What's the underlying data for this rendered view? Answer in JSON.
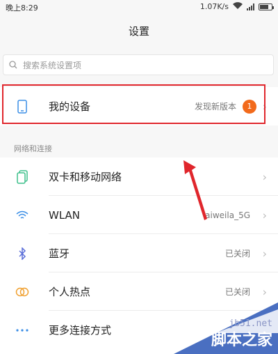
{
  "status_bar": {
    "time": "晚上8:29",
    "speed": "1.07K/s"
  },
  "title": "设置",
  "search": {
    "placeholder": "搜索系统设置项"
  },
  "device": {
    "label": "我的设备",
    "update_text": "发现新版本",
    "badge_count": "1"
  },
  "network_section": {
    "header": "网络和连接",
    "items": [
      {
        "label": "双卡和移动网络",
        "value": "",
        "icon": "sim-card-icon"
      },
      {
        "label": "WLAN",
        "value": "aiweila_5G",
        "icon": "wifi-icon"
      },
      {
        "label": "蓝牙",
        "value": "已关闭",
        "icon": "bluetooth-icon"
      },
      {
        "label": "个人热点",
        "value": "已关闭",
        "icon": "hotspot-icon"
      },
      {
        "label": "更多连接方式",
        "value": "",
        "icon": "more-dots-icon"
      }
    ]
  },
  "watermark": {
    "url": "jb51.net",
    "brand": "脚本之家"
  },
  "colors": {
    "highlight_border": "#e0262c",
    "badge": "#f26a1b",
    "arrow": "#e0262c",
    "watermark_bg": "#4a6fc1"
  }
}
